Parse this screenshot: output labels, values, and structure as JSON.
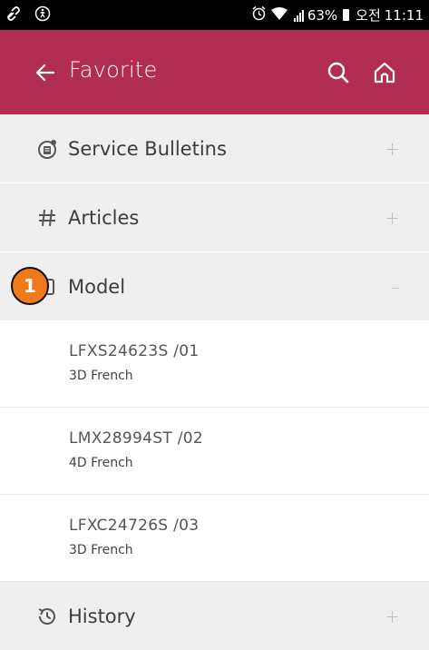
{
  "status_bar": {
    "battery": "63%",
    "time_prefix": "오전",
    "time": "11:11",
    "icons": [
      "link-icon",
      "accessibility-icon",
      "alarm-icon",
      "wifi-icon",
      "signal-icon",
      "battery-icon"
    ]
  },
  "header": {
    "title": "Favorite",
    "background": "#b22d52",
    "icons": [
      "back-arrow-icon",
      "search-icon",
      "home-icon"
    ]
  },
  "menu": [
    {
      "label": "Service Bulletins",
      "toggle": "+",
      "icon": "bulletin-icon"
    },
    {
      "label": "Articles",
      "toggle": "+",
      "icon": "hash-icon"
    },
    {
      "label": "Model",
      "toggle": "–",
      "icon": "model-icon"
    },
    {
      "label": "History",
      "toggle": "+",
      "icon": "history-icon"
    }
  ],
  "model_items": [
    {
      "title": "LFXS24623S /01",
      "desc": "3D French"
    },
    {
      "title": "LMX28994ST /02",
      "desc": "4D French"
    },
    {
      "title": "LFXC24726S /03",
      "desc": "3D French"
    }
  ],
  "callout": {
    "number": "1",
    "color": "#f07a1a"
  }
}
